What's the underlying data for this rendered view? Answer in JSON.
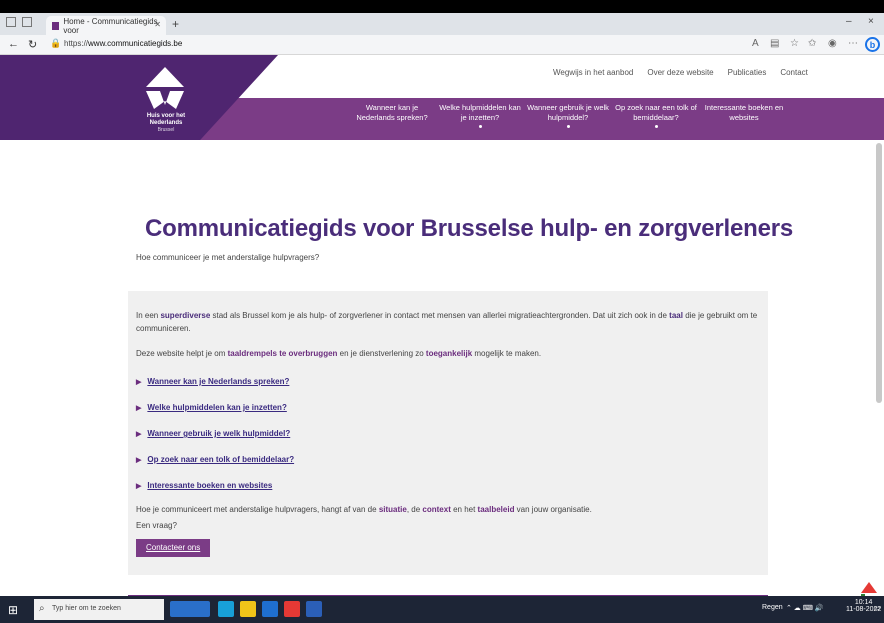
{
  "browser": {
    "tab_title": "Home - Communicatiegids voor",
    "url_prefix": "https://",
    "url_domain": "www.communicatiegids.be",
    "window_controls": [
      "–",
      "□",
      "×"
    ]
  },
  "site": {
    "top_links": [
      "Wegwijs in het aanbod",
      "Over deze website",
      "Publicaties",
      "Contact"
    ],
    "logo_text": "Huis voor het Nederlands",
    "logo_sub": "Brussel",
    "nav": [
      "Wanneer kan je Nederlands spreken?",
      "Welke hulpmiddelen kan je inzetten?",
      "Wanneer gebruik je welk hulpmiddel?",
      "Op zoek naar een tolk of bemiddelaar?",
      "Interessante boeken en websites"
    ]
  },
  "content": {
    "title": "Communicatiegids voor Brusselse hulp- en zorgverleners",
    "subtitle": "Hoe communiceer je met anderstalige hulpvragers?",
    "intro_a": "In een ",
    "intro_b": "superdiverse",
    "intro_c": " stad als Brussel kom je als hulp- of zorgverlener in contact met mensen van allerlei migratieachtergronden. Dat uit zich ook in de ",
    "intro_d": "taal",
    "intro_e": " die je gebruikt om te communiceren.",
    "aim_a": "Deze website helpt je om ",
    "aim_b": "taaldrempels te overbruggen",
    "aim_c": " en je dienstverlening zo ",
    "aim_d": "toegankelijk",
    "aim_e": " mogelijk te maken.",
    "links": [
      "Wanneer kan je Nederlands spreken?",
      "Welke hulpmiddelen kan je inzetten?",
      "Wanneer gebruik je welk hulpmiddel?",
      "Op zoek naar een tolk of bemiddelaar?",
      "Interessante boeken en websites"
    ],
    "outro_a": "Hoe je communiceert met anderstalige hulpvragers, hangt af van de ",
    "outro_b": "situatie",
    "outro_c": ", de ",
    "outro_d": "context",
    "outro_e": " en het ",
    "outro_f": "taalbeleid",
    "outro_g": " van jouw organisatie.",
    "question": "Een vraag?",
    "cta": "Contacteer ons"
  },
  "taskbar": {
    "search_placeholder": "Typ hier om te zoeken",
    "tray_text": "Regen",
    "time": "10:14",
    "date": "11-08-2022",
    "icons": [
      {
        "name": "news-icon",
        "color": "#2a6fc9"
      },
      {
        "name": "edge-icon",
        "color": "#18a0d8"
      },
      {
        "name": "file-explorer-icon",
        "color": "#f0c419"
      },
      {
        "name": "outlook-icon",
        "color": "#1f6fd0"
      },
      {
        "name": "acrobat-icon",
        "color": "#e53935"
      },
      {
        "name": "word-icon",
        "color": "#2b5fb8"
      }
    ]
  }
}
